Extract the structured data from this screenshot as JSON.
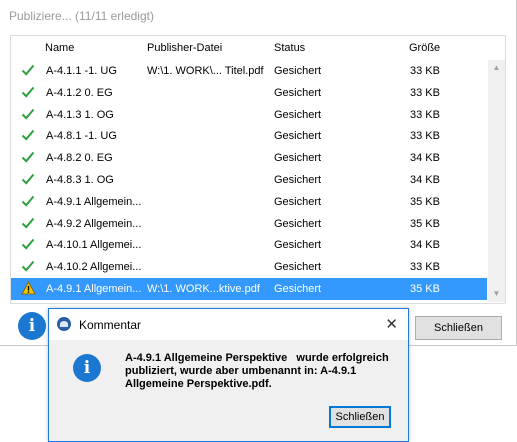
{
  "window": {
    "title": "Publiziere... (11/11 erledigt)"
  },
  "columns": {
    "name": "Name",
    "file": "Publisher-Datei",
    "status": "Status",
    "size": "Größe"
  },
  "rows": [
    {
      "icon": "check-icon",
      "name": "A-4.1.1 -1. UG",
      "file": "W:\\1. WORK\\... Titel.pdf",
      "status": "Gesichert",
      "size": "33 KB",
      "selected": false
    },
    {
      "icon": "check-icon",
      "name": "A-4.1.2 0. EG",
      "file": "",
      "status": "Gesichert",
      "size": "33 KB",
      "selected": false
    },
    {
      "icon": "check-icon",
      "name": "A-4.1.3 1. OG",
      "file": "",
      "status": "Gesichert",
      "size": "33 KB",
      "selected": false
    },
    {
      "icon": "check-icon",
      "name": "A-4.8.1 -1. UG",
      "file": "",
      "status": "Gesichert",
      "size": "33 KB",
      "selected": false
    },
    {
      "icon": "check-icon",
      "name": "A-4.8.2 0. EG",
      "file": "",
      "status": "Gesichert",
      "size": "34 KB",
      "selected": false
    },
    {
      "icon": "check-icon",
      "name": "A-4.8.3 1. OG",
      "file": "",
      "status": "Gesichert",
      "size": "34 KB",
      "selected": false
    },
    {
      "icon": "check-icon",
      "name": "A-4.9.1 Allgemein...",
      "file": "",
      "status": "Gesichert",
      "size": "35 KB",
      "selected": false
    },
    {
      "icon": "check-icon",
      "name": "A-4.9.2 Allgemein...",
      "file": "",
      "status": "Gesichert",
      "size": "35 KB",
      "selected": false
    },
    {
      "icon": "check-icon",
      "name": "A-4.10.1 Allgemei...",
      "file": "",
      "status": "Gesichert",
      "size": "34 KB",
      "selected": false
    },
    {
      "icon": "check-icon",
      "name": "A-4.10.2 Allgemei...",
      "file": "",
      "status": "Gesichert",
      "size": "33 KB",
      "selected": false
    },
    {
      "icon": "warning-icon",
      "name": "A-4.9.1 Allgemein...",
      "file": "W:\\1. WORK...ktive.pdf",
      "status": "Gesichert",
      "size": "35 KB",
      "selected": true
    }
  ],
  "main_close_label": "Schließen",
  "dialog": {
    "title": "Kommentar",
    "close_glyph": "✕",
    "message_line1": "A-4.9.1 Allgemeine Perspektive   wurde erfolgreich",
    "message_line2": "publiziert, wurde aber umbenannt in: A-4.9.1",
    "message_line3": "Allgemeine Perspektive.pdf.",
    "button_label": "Schließen"
  },
  "info_glyph": "i",
  "colors": {
    "selection": "#3399ff",
    "check": "#2e9e3e",
    "info": "#1b77d0",
    "warning": "#f5c400"
  }
}
